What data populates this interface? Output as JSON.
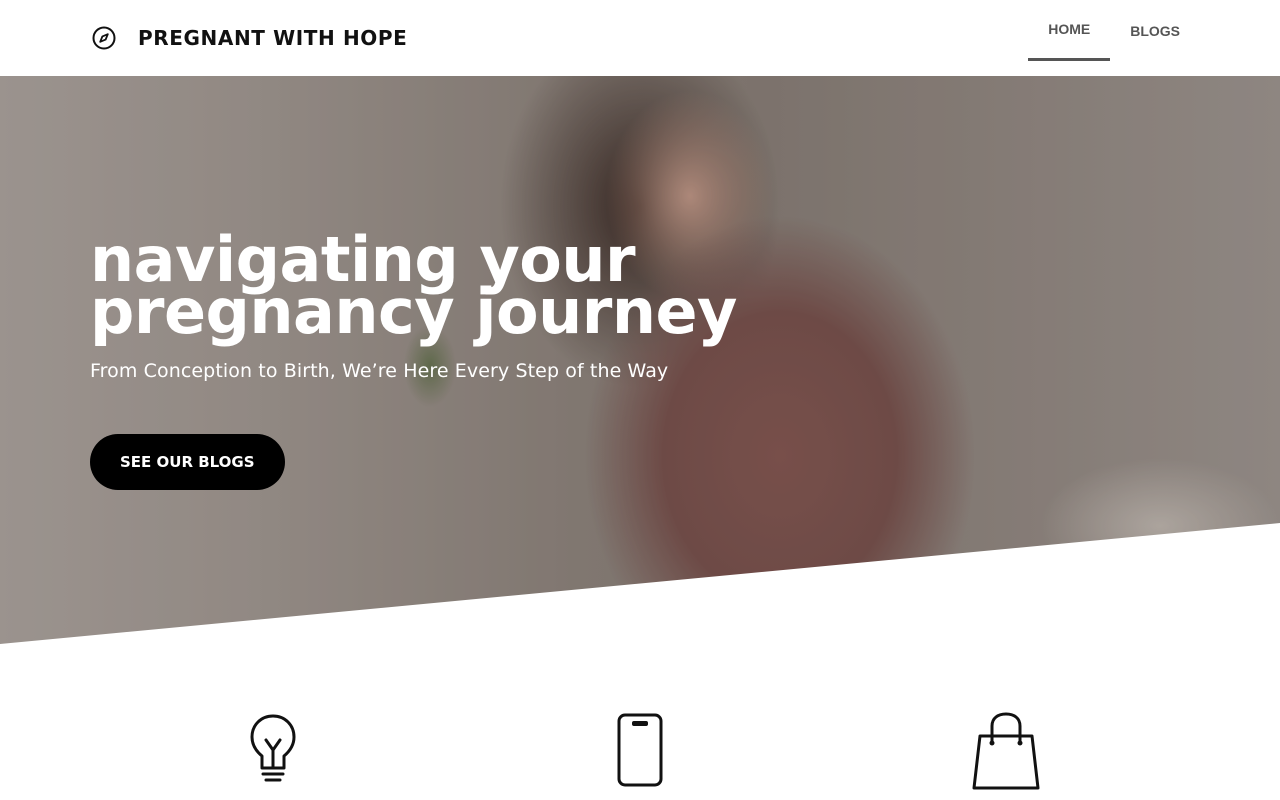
{
  "header": {
    "brand_icon": "compass-icon",
    "brand_name": "PREGNANT WITH HOPE",
    "nav": [
      {
        "label": "HOME",
        "active": true
      },
      {
        "label": "BLOGS",
        "active": false
      }
    ]
  },
  "hero": {
    "title_line1": "navigating your",
    "title_line2": "pregnancy journey",
    "subtitle": "From Conception to Birth, We’re Here Every Step of the Way",
    "cta_label": "SEE OUR BLOGS",
    "image": "photo of smiling pregnant woman holding belly"
  },
  "features": {
    "icons": [
      "lightbulb-icon",
      "smartphone-icon",
      "shopping-bag-icon"
    ]
  },
  "colors": {
    "header_bg": "#ffffff",
    "nav_text": "#555555",
    "cta_bg": "#000000",
    "cta_text": "#ffffff",
    "hero_text": "#ffffff"
  }
}
